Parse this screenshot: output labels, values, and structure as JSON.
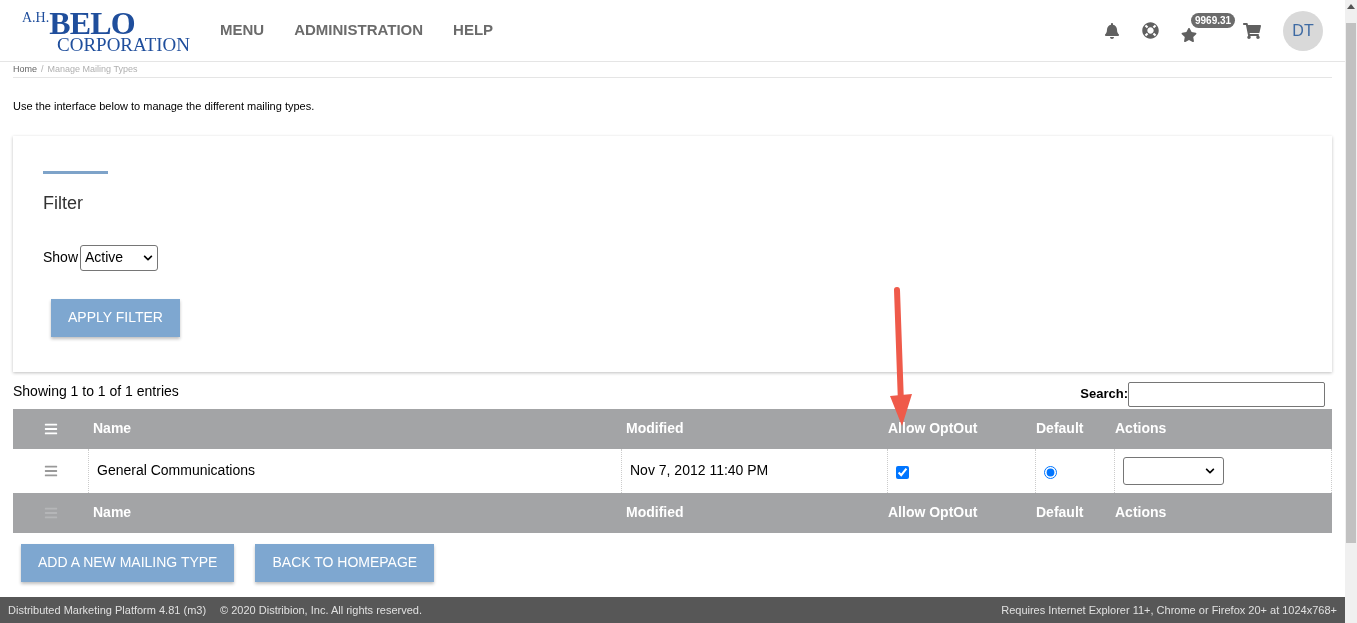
{
  "header": {
    "logo": {
      "top_left": "A.H.",
      "main": "BELO",
      "bottom": "CORPORATION"
    },
    "nav": [
      "MENU",
      "ADMINISTRATION",
      "HELP"
    ],
    "points_badge": "9969.31",
    "avatar": "DT"
  },
  "breadcrumb": [
    "Home",
    "/",
    "Manage Mailing Types"
  ],
  "intro": "Use the interface below to manage the different mailing types.",
  "filter": {
    "title": "Filter",
    "show_label": "Show",
    "show_value": "Active",
    "apply_button": "APPLY FILTER"
  },
  "table": {
    "info": "Showing 1 to 1 of 1 entries",
    "search_label": "Search:",
    "columns": [
      "Name",
      "Modified",
      "Allow OptOut",
      "Default",
      "Actions"
    ],
    "footer_columns": [
      "Name",
      "Modified",
      "Allow OptOut",
      "Default",
      "Actions"
    ],
    "rows": [
      {
        "name": "General Communications",
        "modified": "Nov 7, 2012 11:40 PM",
        "allow_optout": true,
        "default_selected": true
      }
    ]
  },
  "buttons": [
    "ADD A NEW MAILING TYPE",
    "BACK TO HOMEPAGE"
  ],
  "footer": {
    "left": "Distributed Marketing Platform 4.81 (m3)",
    "copyright": "© 2020 Distribion, Inc. All rights reserved.",
    "right": "Requires Internet Explorer 11+, Chrome or Firefox 20+ at 1024x768+"
  }
}
